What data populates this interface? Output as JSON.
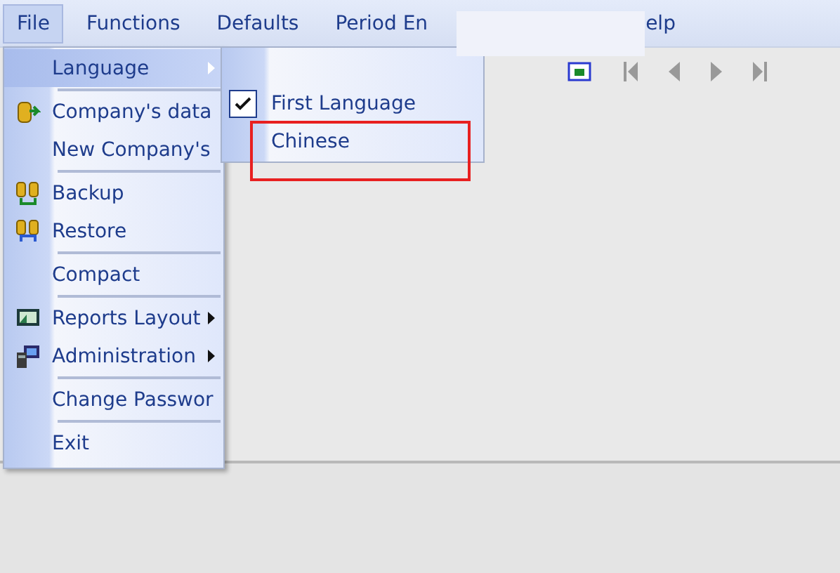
{
  "menu_bar": {
    "items": [
      {
        "label": "File",
        "selected": true
      },
      {
        "label": "Functions",
        "selected": false
      },
      {
        "label": "Defaults",
        "selected": false
      },
      {
        "label": "Period En",
        "selected": false
      },
      {
        "label": "elp",
        "selected": false
      }
    ]
  },
  "file_menu": {
    "items": [
      {
        "kind": "item",
        "label": "Language",
        "submenu": true,
        "selected": true
      },
      {
        "kind": "separator"
      },
      {
        "kind": "item",
        "label": "Company's data",
        "submenu": false,
        "selected": false
      },
      {
        "kind": "item",
        "label": "New Company's",
        "submenu": false,
        "selected": false
      },
      {
        "kind": "separator"
      },
      {
        "kind": "item",
        "label": "Backup",
        "submenu": false,
        "selected": false
      },
      {
        "kind": "item",
        "label": "Restore",
        "submenu": false,
        "selected": false
      },
      {
        "kind": "separator"
      },
      {
        "kind": "item",
        "label": "Compact",
        "submenu": false,
        "selected": false
      },
      {
        "kind": "separator"
      },
      {
        "kind": "item",
        "label": "Reports Layout",
        "submenu": true,
        "selected": false
      },
      {
        "kind": "item",
        "label": "Administration",
        "submenu": true,
        "selected": false
      },
      {
        "kind": "separator"
      },
      {
        "kind": "item",
        "label": "Change Passwor",
        "submenu": false,
        "selected": false
      },
      {
        "kind": "separator"
      },
      {
        "kind": "item",
        "label": "Exit",
        "submenu": false,
        "selected": false
      }
    ]
  },
  "language_submenu": {
    "items": [
      {
        "label": "First Language",
        "checked": true,
        "annotated": false
      },
      {
        "label": "Chinese",
        "checked": false,
        "annotated": true
      }
    ]
  }
}
